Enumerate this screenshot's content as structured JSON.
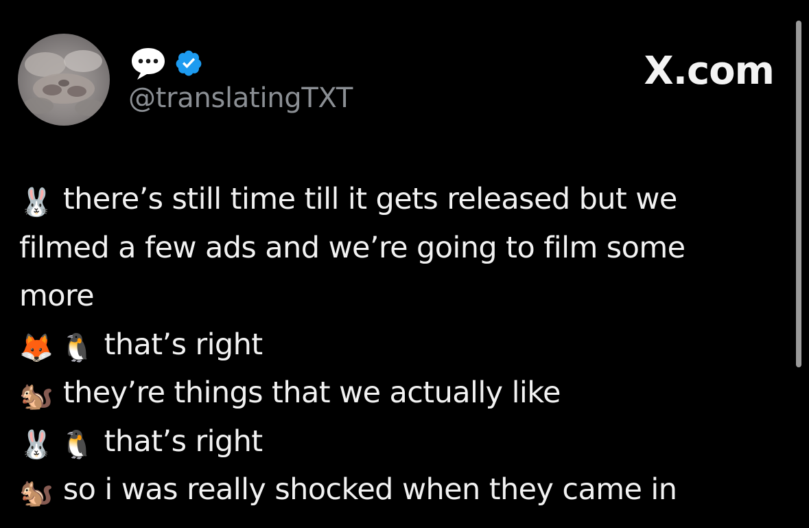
{
  "profile": {
    "handle": "@translatingTXT",
    "site": "X.com"
  },
  "icons": {
    "speech": "speech-balloon-icon",
    "verified": "verified-badge-icon"
  },
  "colors": {
    "background": "#000000",
    "text": "#f2f2f2",
    "handle": "#8b8f94",
    "verified": "#1d9bf0"
  },
  "lines": [
    {
      "emoji": "🐰",
      "text": "there’s still time till it gets released but we"
    },
    {
      "text": "filmed a few ads and we’re going to film some"
    },
    {
      "text": "more"
    },
    {
      "emoji": "🦊",
      "emoji2": "🐧",
      "text": "that’s right"
    },
    {
      "emoji": "🐿️",
      "text": "they’re things that we actually like"
    },
    {
      "emoji": "🐰",
      "emoji2": "🐧",
      "text": "that’s right"
    },
    {
      "emoji": "🐿️",
      "text": "so i was really shocked when they came in"
    }
  ]
}
